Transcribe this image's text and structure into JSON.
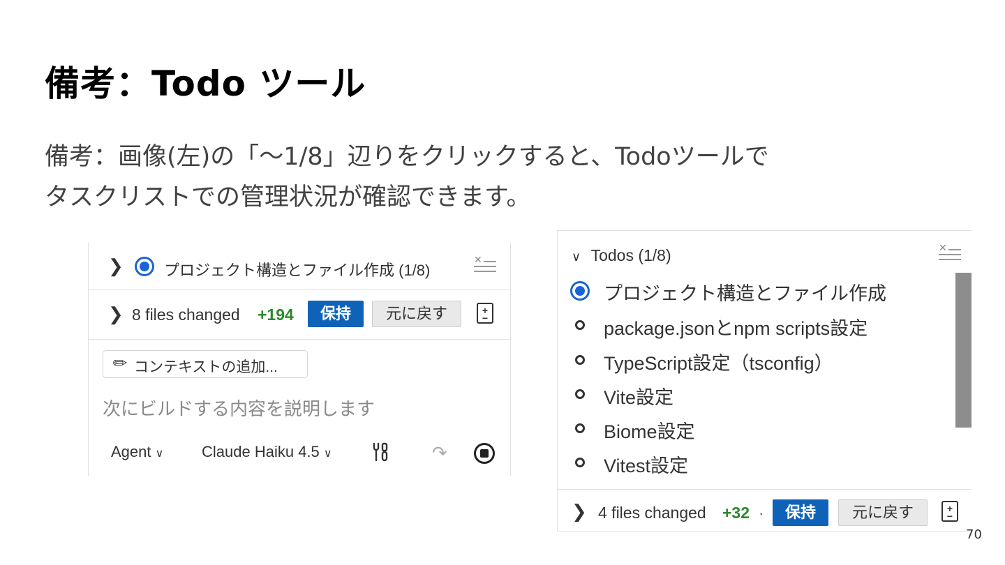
{
  "slide": {
    "title": "備考：Todo ツール",
    "body_line1": "備考：画像(左)の「～1/8」辺りをクリックすると、Todoツールで",
    "body_line2": "タスクリストでの管理状況が確認できます。",
    "page_number": "70"
  },
  "left_panel": {
    "current_task": "プロジェクト構造とファイル作成 (1/8)",
    "files_changed": "8 files changed",
    "additions": "+194",
    "keep_label": "保持",
    "undo_label": "元に戻す",
    "add_context_label": "コンテキストの追加...",
    "prompt_placeholder": "次にビルドする内容を説明します",
    "mode_label": "Agent",
    "model_label": "Claude Haiku 4.5"
  },
  "right_panel": {
    "header": "Todos (1/8)",
    "todos": [
      {
        "label": "プロジェクト構造とファイル作成",
        "status": "in-progress"
      },
      {
        "label": "package.jsonとnpm scripts設定",
        "status": "not-started"
      },
      {
        "label": "TypeScript設定（tsconfig）",
        "status": "not-started"
      },
      {
        "label": "Vite設定",
        "status": "not-started"
      },
      {
        "label": "Biome設定",
        "status": "not-started"
      },
      {
        "label": "Vitest設定",
        "status": "not-started"
      }
    ],
    "files_changed": "4 files changed",
    "additions": "+32",
    "separator": "·",
    "keep_label": "保持",
    "undo_label": "元に戻す"
  },
  "colors": {
    "accent_blue": "#1a64d8",
    "keep_button": "#0e63b8",
    "additions_green": "#2a8a2a"
  },
  "icons": {
    "expand": "chevron-right-icon",
    "collapse": "chevron-down-icon",
    "clear": "clear-list-icon",
    "diff": "diff-file-icon",
    "attach": "paperclip-icon",
    "tools": "tools-icon",
    "send": "send-icon",
    "stop": "stop-icon"
  }
}
